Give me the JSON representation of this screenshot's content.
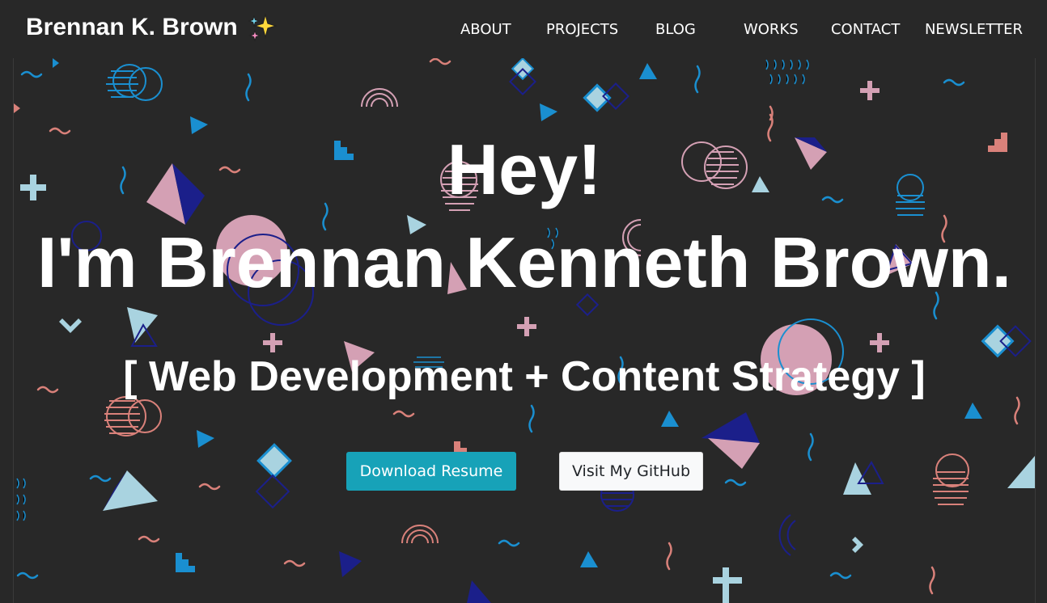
{
  "brand": {
    "name": "Brennan K. Brown",
    "emoji_icon": "sparkles-icon"
  },
  "nav": {
    "items": [
      {
        "label": "ABOUT"
      },
      {
        "label": "PROJECTS"
      },
      {
        "label": "BLOG"
      },
      {
        "label": "WORKS"
      },
      {
        "label": "CONTACT"
      },
      {
        "label": "NEWSLETTER"
      }
    ]
  },
  "hero": {
    "greeting": "Hey!",
    "name": "I'm Brennan Kenneth Brown.",
    "tagline": "[ Web Development + Content Strategy ]",
    "primary_button": "Download Resume",
    "secondary_button": "Visit My GitHub"
  },
  "colors": {
    "background": "#282828",
    "primary_button": "#17a2b8",
    "light_button": "#f8f9fa",
    "pink": "#d4a0b4",
    "salmon": "#d9817a",
    "blue": "#1a8fd0",
    "light_blue": "#a9d3e0",
    "navy": "#1b1f8a"
  }
}
